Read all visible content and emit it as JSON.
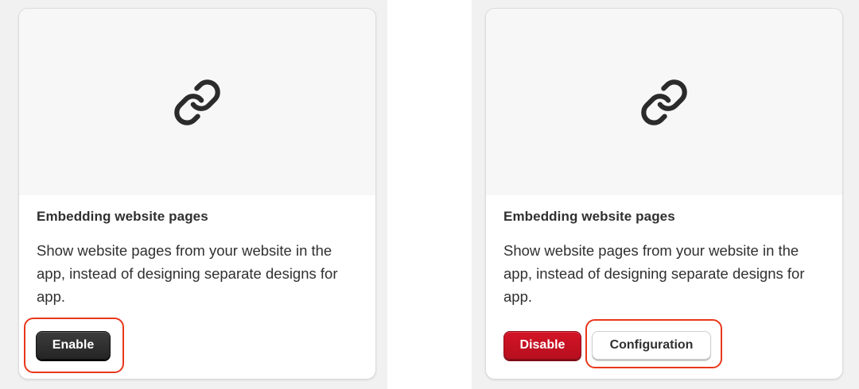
{
  "cards": [
    {
      "icon": "link-icon",
      "title": "Embedding website pages",
      "description": "Show website pages from your website in the app, instead of designing separate designs for app.",
      "buttons": {
        "enable": "Enable"
      }
    },
    {
      "icon": "link-icon",
      "title": "Embedding website pages",
      "description": "Show website pages from your website in the app, instead of designing separate designs for app.",
      "buttons": {
        "disable": "Disable",
        "configuration": "Configuration"
      }
    }
  ],
  "colors": {
    "primary_button": "#303030",
    "critical_button": "#c8102e",
    "highlight_outline": "#e8381b",
    "hero_background": "#f7f7f7"
  }
}
